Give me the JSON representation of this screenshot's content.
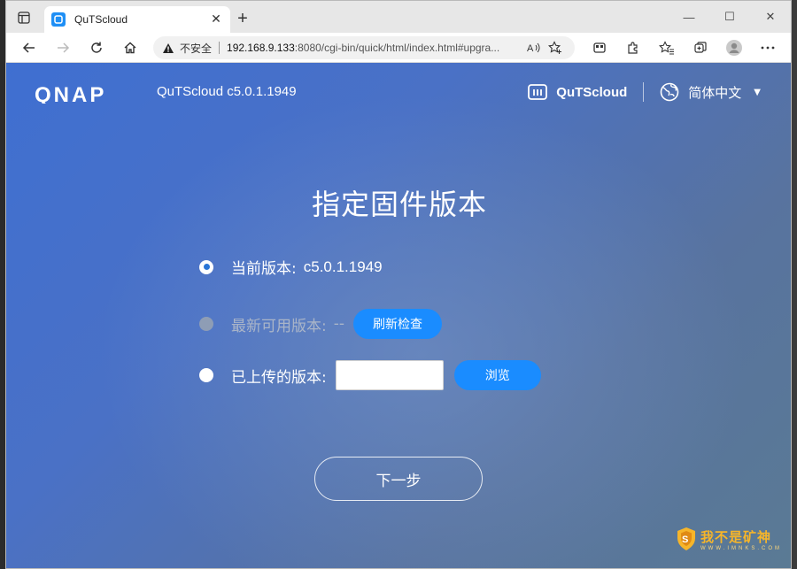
{
  "browser": {
    "tab_title": "QuTScloud",
    "close_tab_label": "✕",
    "new_tab_label": "+",
    "security_label": "不安全",
    "url_host": "192.168.9.133",
    "url_rest": ":8080/cgi-bin/quick/html/index.html#upgra...",
    "window_controls": {
      "minimize": "—",
      "maximize": "☐",
      "close": "✕"
    }
  },
  "header": {
    "brand": "QNAP",
    "product_version": "QuTScloud c5.0.1.1949",
    "product_name": "QuTScloud",
    "language": "简体中文"
  },
  "main": {
    "title": "指定固件版本",
    "options": [
      {
        "label": "当前版本:",
        "value": "c5.0.1.1949",
        "selected": true,
        "enabled": true
      },
      {
        "label": "最新可用版本:",
        "value": "--",
        "selected": false,
        "enabled": false,
        "button": "刷新检查"
      },
      {
        "label": "已上传的版本:",
        "value": "",
        "selected": false,
        "enabled": true,
        "button": "浏览"
      }
    ],
    "next_button": "下一步"
  },
  "watermark": {
    "main": "我不是矿神",
    "sub": "WWW.IMNKS.COM"
  },
  "colors": {
    "accent": "#1a8cff",
    "radio_checked": "#2a75d6",
    "watermark": "#f6b52a"
  }
}
